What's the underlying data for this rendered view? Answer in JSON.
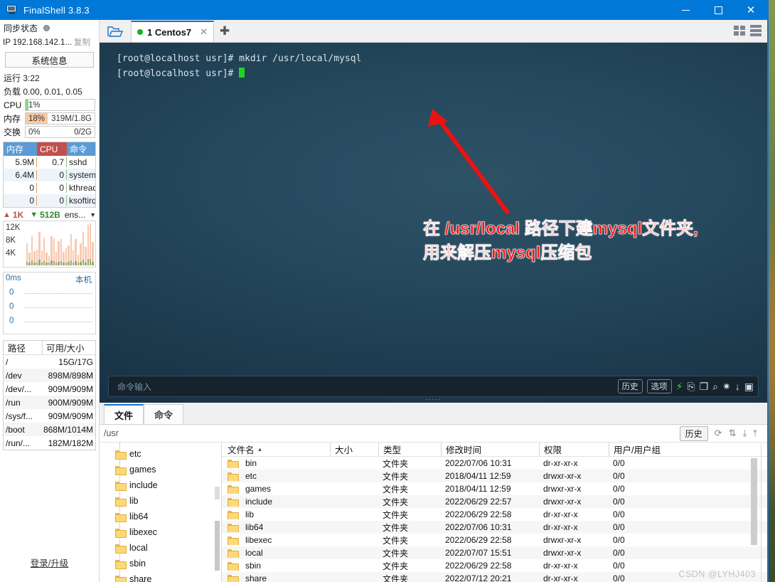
{
  "window": {
    "title": "FinalShell 3.8.3",
    "app_icon": "monitor-icon",
    "minimize": "−",
    "maximize": "□",
    "close": "✕"
  },
  "sidebar": {
    "sync_label": "同步状态",
    "ip_label": "IP 192.168.142.1...",
    "copy_label": "复制",
    "sysinfo_button": "系统信息",
    "uptime_key": "运行",
    "uptime_value": "3:22",
    "load_key": "负载",
    "load_value": "0.00, 0.01, 0.05",
    "meters": [
      {
        "name": "CPU",
        "left": "1%",
        "right": "",
        "pct": 1,
        "color": "#8fd18f"
      },
      {
        "name": "内存",
        "left": "18%",
        "right": "319M/1.8G",
        "pct": 18,
        "color": "#f8c9a0"
      },
      {
        "name": "交换",
        "left": "0%",
        "right": "0/2G",
        "pct": 0,
        "color": "#c9d8f0"
      }
    ],
    "proc_headers": [
      "内存",
      "CPU",
      "命令"
    ],
    "proc_rows": [
      {
        "mem": "5.9M",
        "cpu": "0.7",
        "cmd": "sshd"
      },
      {
        "mem": "6.4M",
        "cpu": "0",
        "cmd": "systemd"
      },
      {
        "mem": "0",
        "cpu": "0",
        "cmd": "kthreadd"
      },
      {
        "mem": "0",
        "cpu": "0",
        "cmd": "ksoftirqd"
      }
    ],
    "net": {
      "up_value": "1K",
      "down_value": "512B",
      "interface": "ens...",
      "caret": "▼",
      "chart_y_labels": [
        "12K",
        "8K",
        "4K"
      ]
    },
    "ping": {
      "label": "0ms",
      "right_label": "本机",
      "y_labels": [
        "0",
        "0",
        "0"
      ]
    },
    "disk_headers": [
      "路径",
      "可用/大小"
    ],
    "disk_rows": [
      {
        "path": "/",
        "size": "15G/17G"
      },
      {
        "path": "/dev",
        "size": "898M/898M"
      },
      {
        "path": "/dev/...",
        "size": "909M/909M"
      },
      {
        "path": "/run",
        "size": "900M/909M"
      },
      {
        "path": "/sys/f...",
        "size": "909M/909M"
      },
      {
        "path": "/boot",
        "size": "868M/1014M"
      },
      {
        "path": "/run/...",
        "size": "182M/182M"
      }
    ],
    "login_link": "登录/升级"
  },
  "tabbar": {
    "folder_icon": "open-folder-icon",
    "tab_label": "1 Centos7",
    "tab_close": "✕",
    "new_tab": "✚",
    "view_grid_icon": "grid-view-icon",
    "view_list_icon": "list-view-icon"
  },
  "terminal": {
    "line1": "[root@localhost usr]# mkdir /usr/local/mysql",
    "line2": "[root@localhost usr]# ",
    "annotation_line1": "在 /usr/local 路径下建mysql文件夹,",
    "annotation_line2": "用来解压mysql压缩包",
    "annotation_color": "#ff1414",
    "command_placeholder": "命令输入",
    "history_button": "历史",
    "options_button": "选项",
    "icons": [
      "bolt-icon",
      "copy-icon",
      "paste-icon",
      "search-icon",
      "gear-icon",
      "download-icon",
      "window-icon"
    ]
  },
  "bottom": {
    "tabs": [
      {
        "label": "文件",
        "active": true
      },
      {
        "label": "命令",
        "active": false
      }
    ],
    "path_value": "/usr",
    "history_button": "历史",
    "toolbar_icons": [
      "refresh-icon",
      "sort-icon",
      "download-icon",
      "upload-icon"
    ],
    "tree_items": [
      "etc",
      "games",
      "include",
      "lib",
      "lib64",
      "libexec",
      "local",
      "sbin",
      "share"
    ],
    "columns": [
      "文件名",
      "大小",
      "类型",
      "修改时间",
      "权限",
      "用户/用户组"
    ],
    "rows": [
      {
        "name": "bin",
        "size": "",
        "type": "文件夹",
        "time": "2022/07/06 10:31",
        "perm": "dr-xr-xr-x",
        "user": "0/0"
      },
      {
        "name": "etc",
        "size": "",
        "type": "文件夹",
        "time": "2018/04/11 12:59",
        "perm": "drwxr-xr-x",
        "user": "0/0"
      },
      {
        "name": "games",
        "size": "",
        "type": "文件夹",
        "time": "2018/04/11 12:59",
        "perm": "drwxr-xr-x",
        "user": "0/0"
      },
      {
        "name": "include",
        "size": "",
        "type": "文件夹",
        "time": "2022/06/29 22:57",
        "perm": "drwxr-xr-x",
        "user": "0/0"
      },
      {
        "name": "lib",
        "size": "",
        "type": "文件夹",
        "time": "2022/06/29 22:58",
        "perm": "dr-xr-xr-x",
        "user": "0/0"
      },
      {
        "name": "lib64",
        "size": "",
        "type": "文件夹",
        "time": "2022/07/06 10:31",
        "perm": "dr-xr-xr-x",
        "user": "0/0"
      },
      {
        "name": "libexec",
        "size": "",
        "type": "文件夹",
        "time": "2022/06/29 22:58",
        "perm": "drwxr-xr-x",
        "user": "0/0"
      },
      {
        "name": "local",
        "size": "",
        "type": "文件夹",
        "time": "2022/07/07 15:51",
        "perm": "drwxr-xr-x",
        "user": "0/0"
      },
      {
        "name": "sbin",
        "size": "",
        "type": "文件夹",
        "time": "2022/06/29 22:58",
        "perm": "dr-xr-xr-x",
        "user": "0/0"
      },
      {
        "name": "share",
        "size": "",
        "type": "文件夹",
        "time": "2022/07/12 20:21",
        "perm": "dr-xr-xr-x",
        "user": "0/0"
      }
    ],
    "watermark": "CSDN @LYHJ403"
  }
}
